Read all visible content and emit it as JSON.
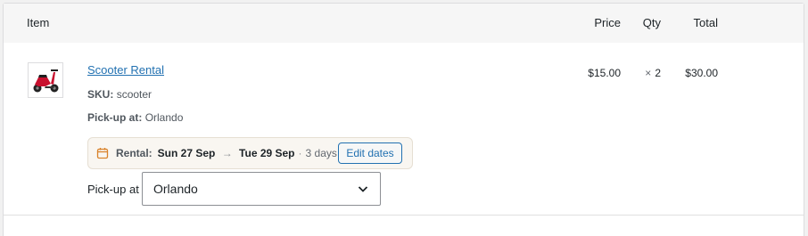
{
  "table": {
    "headers": {
      "item": "Item",
      "price": "Price",
      "qty": "Qty",
      "total": "Total"
    }
  },
  "line_item": {
    "thumbnail_icon": "scooter-image",
    "name": "Scooter Rental",
    "sku_label": "SKU:",
    "sku_value": "scooter",
    "pickup_label": "Pick-up at:",
    "pickup_value": "Orlando",
    "rental": {
      "icon": "calendar-icon",
      "label": "Rental:",
      "start": "Sun 27 Sep",
      "arrow": "→",
      "end": "Tue 29 Sep",
      "separator": "·",
      "duration": "3 days",
      "edit_label": "Edit dates"
    },
    "pickup_select": {
      "label": "Pick-up at",
      "selected": "Orlando"
    },
    "price": "$15.00",
    "qty_prefix": "×",
    "qty": "2",
    "total": "$30.00"
  },
  "colors": {
    "link": "#2271b1",
    "rental_bg": "#f9f6f1",
    "calendar_icon": "#d9822b",
    "scooter_red": "#c8102e"
  }
}
